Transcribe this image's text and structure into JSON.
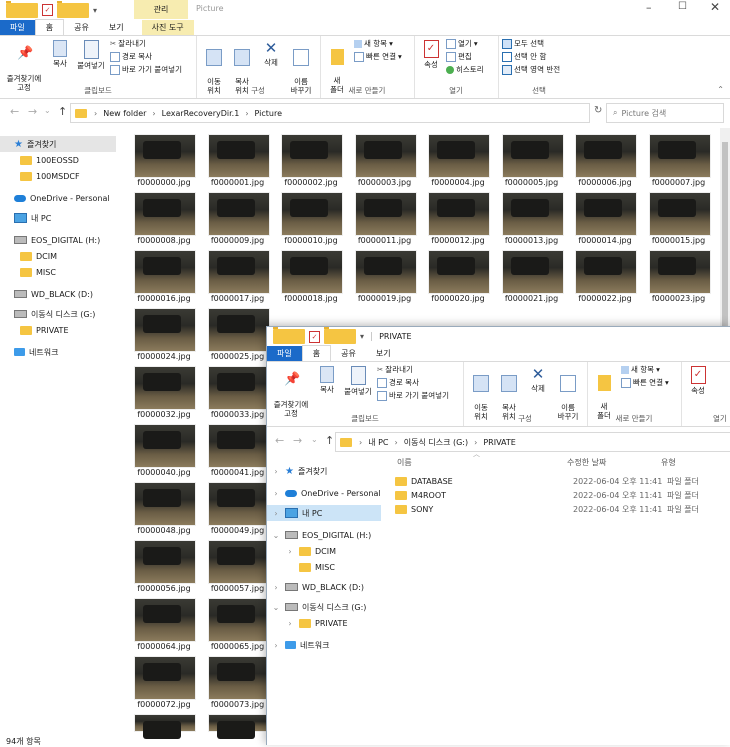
{
  "back_window": {
    "title": "Picture",
    "context_tab_group": "관리",
    "tabs": [
      "파일",
      "홈",
      "공유",
      "보기",
      "사진 도구"
    ],
    "ribbon": {
      "pin_label": "즐겨찾기에\n고정",
      "copy_label": "복사",
      "paste_label": "붙여넣기",
      "cut_label": "잘라내기",
      "copy_path_label": "경로 복사",
      "paste_shortcut_label": "바로 가기 붙여넣기",
      "clipboard_group": "클립보드",
      "move_to_label": "이동\n위치",
      "copy_to_label": "복사\n위치",
      "delete_label": "삭제",
      "rename_label": "이름\n바꾸기",
      "organize_group": "구성",
      "new_folder_label": "새\n폴더",
      "new_item_label": "새 항목",
      "easy_access_label": "빠른 연결",
      "new_group": "새로 만들기",
      "properties_label": "속성",
      "open_label": "열기",
      "edit_label": "편집",
      "history_label": "히스토리",
      "open_group": "열기",
      "select_all_label": "모두 선택",
      "select_none_label": "선택 안 함",
      "invert_label": "선택 영역 반전",
      "select_group": "선택"
    },
    "path": [
      "New folder",
      "LexarRecoveryDir.1",
      "Picture"
    ],
    "search_placeholder": "Picture 검색",
    "sidebar": [
      {
        "label": "즐겨찾기",
        "kind": "star",
        "indent": 0
      },
      {
        "label": "100EOSSD",
        "kind": "folder",
        "indent": 1
      },
      {
        "label": "100MSDCF",
        "kind": "folder",
        "indent": 1
      },
      {
        "label": "OneDrive - Personal",
        "kind": "cloud",
        "indent": 0
      },
      {
        "label": "내 PC",
        "kind": "pc",
        "indent": 0
      },
      {
        "label": "EOS_DIGITAL (H:)",
        "kind": "drive",
        "indent": 0
      },
      {
        "label": "DCIM",
        "kind": "folder",
        "indent": 1
      },
      {
        "label": "MISC",
        "kind": "folder",
        "indent": 1
      },
      {
        "label": "WD_BLACK (D:)",
        "kind": "drive",
        "indent": 0
      },
      {
        "label": "이동식 디스크 (G:)",
        "kind": "drive",
        "indent": 0
      },
      {
        "label": "PRIVATE",
        "kind": "folder",
        "indent": 1
      },
      {
        "label": "네트워크",
        "kind": "net",
        "indent": 0
      }
    ],
    "files": [
      "f0000000.jpg",
      "f0000001.jpg",
      "f0000002.jpg",
      "f0000003.jpg",
      "f0000004.jpg",
      "f0000005.jpg",
      "f0000006.jpg",
      "f0000007.jpg",
      "f0000008.jpg",
      "f0000009.jpg",
      "f0000010.jpg",
      "f0000011.jpg",
      "f0000012.jpg",
      "f0000013.jpg",
      "f0000014.jpg",
      "f0000015.jpg",
      "f0000016.jpg",
      "f0000017.jpg",
      "f0000018.jpg",
      "f0000019.jpg",
      "f0000020.jpg",
      "f0000021.jpg",
      "f0000022.jpg",
      "f0000023.jpg",
      "f0000024.jpg",
      "f0000025.jpg",
      "f0000032.jpg",
      "f0000033.jpg",
      "f0000040.jpg",
      "f0000041.jpg",
      "f0000048.jpg",
      "f0000049.jpg",
      "f0000056.jpg",
      "f0000057.jpg",
      "f0000064.jpg",
      "f0000065.jpg",
      "f0000072.jpg",
      "f0000073.jpg"
    ],
    "status": "94개 항목"
  },
  "front_window": {
    "title": "PRIVATE",
    "tabs": [
      "파일",
      "홈",
      "공유",
      "보기"
    ],
    "ribbon": {
      "pin_label": "즐겨찾기에\n고정",
      "copy_label": "복사",
      "paste_label": "붙여넣기",
      "cut_label": "잘라내기",
      "copy_path_label": "경로 복사",
      "paste_shortcut_label": "바로 가기 붙여넣기",
      "clipboard_group": "클립보드",
      "move_to_label": "이동\n위치",
      "copy_to_label": "복사\n위치",
      "delete_label": "삭제",
      "rename_label": "이름\n바꾸기",
      "organize_group": "구성",
      "new_folder_label": "새\n폴더",
      "new_item_label": "새 항목",
      "easy_access_label": "빠른 연결",
      "new_group": "새로 만들기",
      "properties_label": "속성",
      "open_group": "열기"
    },
    "path": [
      "내 PC",
      "이동식 디스크 (G:)",
      "PRIVATE"
    ],
    "columns": {
      "name": "이름",
      "modified": "수정한 날짜",
      "type": "유형"
    },
    "rows": [
      {
        "name": "DATABASE",
        "modified": "2022-06-04 오후 11:41",
        "type": "파일 폴더"
      },
      {
        "name": "M4ROOT",
        "modified": "2022-06-04 오후 11:41",
        "type": "파일 폴더"
      },
      {
        "name": "SONY",
        "modified": "2022-06-04 오후 11:41",
        "type": "파일 폴더"
      }
    ],
    "sidebar": [
      {
        "label": "즐겨찾기",
        "kind": "star",
        "indent": 0,
        "chev": ">"
      },
      {
        "label": "OneDrive - Personal",
        "kind": "cloud",
        "indent": 0,
        "chev": ">"
      },
      {
        "label": "내 PC",
        "kind": "pc",
        "indent": 0,
        "chev": ">",
        "selected": true
      },
      {
        "label": "EOS_DIGITAL (H:)",
        "kind": "drive",
        "indent": 0,
        "chev": "v"
      },
      {
        "label": "DCIM",
        "kind": "folder",
        "indent": 1,
        "chev": ">"
      },
      {
        "label": "MISC",
        "kind": "folder",
        "indent": 1,
        "chev": ""
      },
      {
        "label": "WD_BLACK (D:)",
        "kind": "drive",
        "indent": 0,
        "chev": ">"
      },
      {
        "label": "이동식 디스크 (G:)",
        "kind": "drive",
        "indent": 0,
        "chev": "v"
      },
      {
        "label": "PRIVATE",
        "kind": "folder",
        "indent": 1,
        "chev": ">"
      },
      {
        "label": "네트워크",
        "kind": "net",
        "indent": 0,
        "chev": ">"
      }
    ]
  }
}
